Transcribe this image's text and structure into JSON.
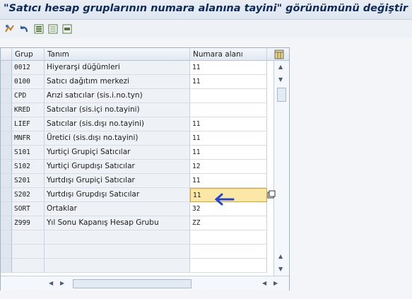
{
  "title": "\"Satıcı hesap gruplarının numara alanına tayini\" görünümünü değiştir",
  "toolbar": {
    "icons": [
      "display-change-icon",
      "undo-icon",
      "select-all-icon",
      "deselect-all-icon",
      "block-select-icon"
    ]
  },
  "table": {
    "columns": {
      "grup": "Grup",
      "tanim": "Tanım",
      "numara": "Numara alanı"
    },
    "rows": [
      {
        "grup": "0012",
        "tanim": "Hiyerarşi düğümleri",
        "numara": "11"
      },
      {
        "grup": "0100",
        "tanim": "Satıcı dağıtım merkezi",
        "numara": "11"
      },
      {
        "grup": "CPD",
        "tanim": "Arızi satıcılar (sis.i.no.tyn)",
        "numara": ""
      },
      {
        "grup": "KRED",
        "tanim": "Satıcılar (sis.içi no.tayini)",
        "numara": ""
      },
      {
        "grup": "LIEF",
        "tanim": "Satıcılar (sis.dışı no.tayini)",
        "numara": "11"
      },
      {
        "grup": "MNFR",
        "tanim": "Üretici (sis.dışı no.tayini)",
        "numara": "11"
      },
      {
        "grup": "S101",
        "tanim": "Yurtiçi Grupiçi Satıcılar",
        "numara": "11"
      },
      {
        "grup": "S102",
        "tanim": "Yurtiçi Grupdışı Satıcılar",
        "numara": "12"
      },
      {
        "grup": "S201",
        "tanim": "Yurtdışı Grupiçi Satıcılar",
        "numara": "11"
      },
      {
        "grup": "S202",
        "tanim": "Yurtdışı Grupdışı Satıcılar",
        "numara": "11"
      },
      {
        "grup": "SORT",
        "tanim": "Ortaklar",
        "numara": "32"
      },
      {
        "grup": "Z999",
        "tanim": "Yıl Sonu Kapanış Hesap Grubu",
        "numara": "ZZ"
      }
    ],
    "empty_rows": 3,
    "active_row": 9
  }
}
